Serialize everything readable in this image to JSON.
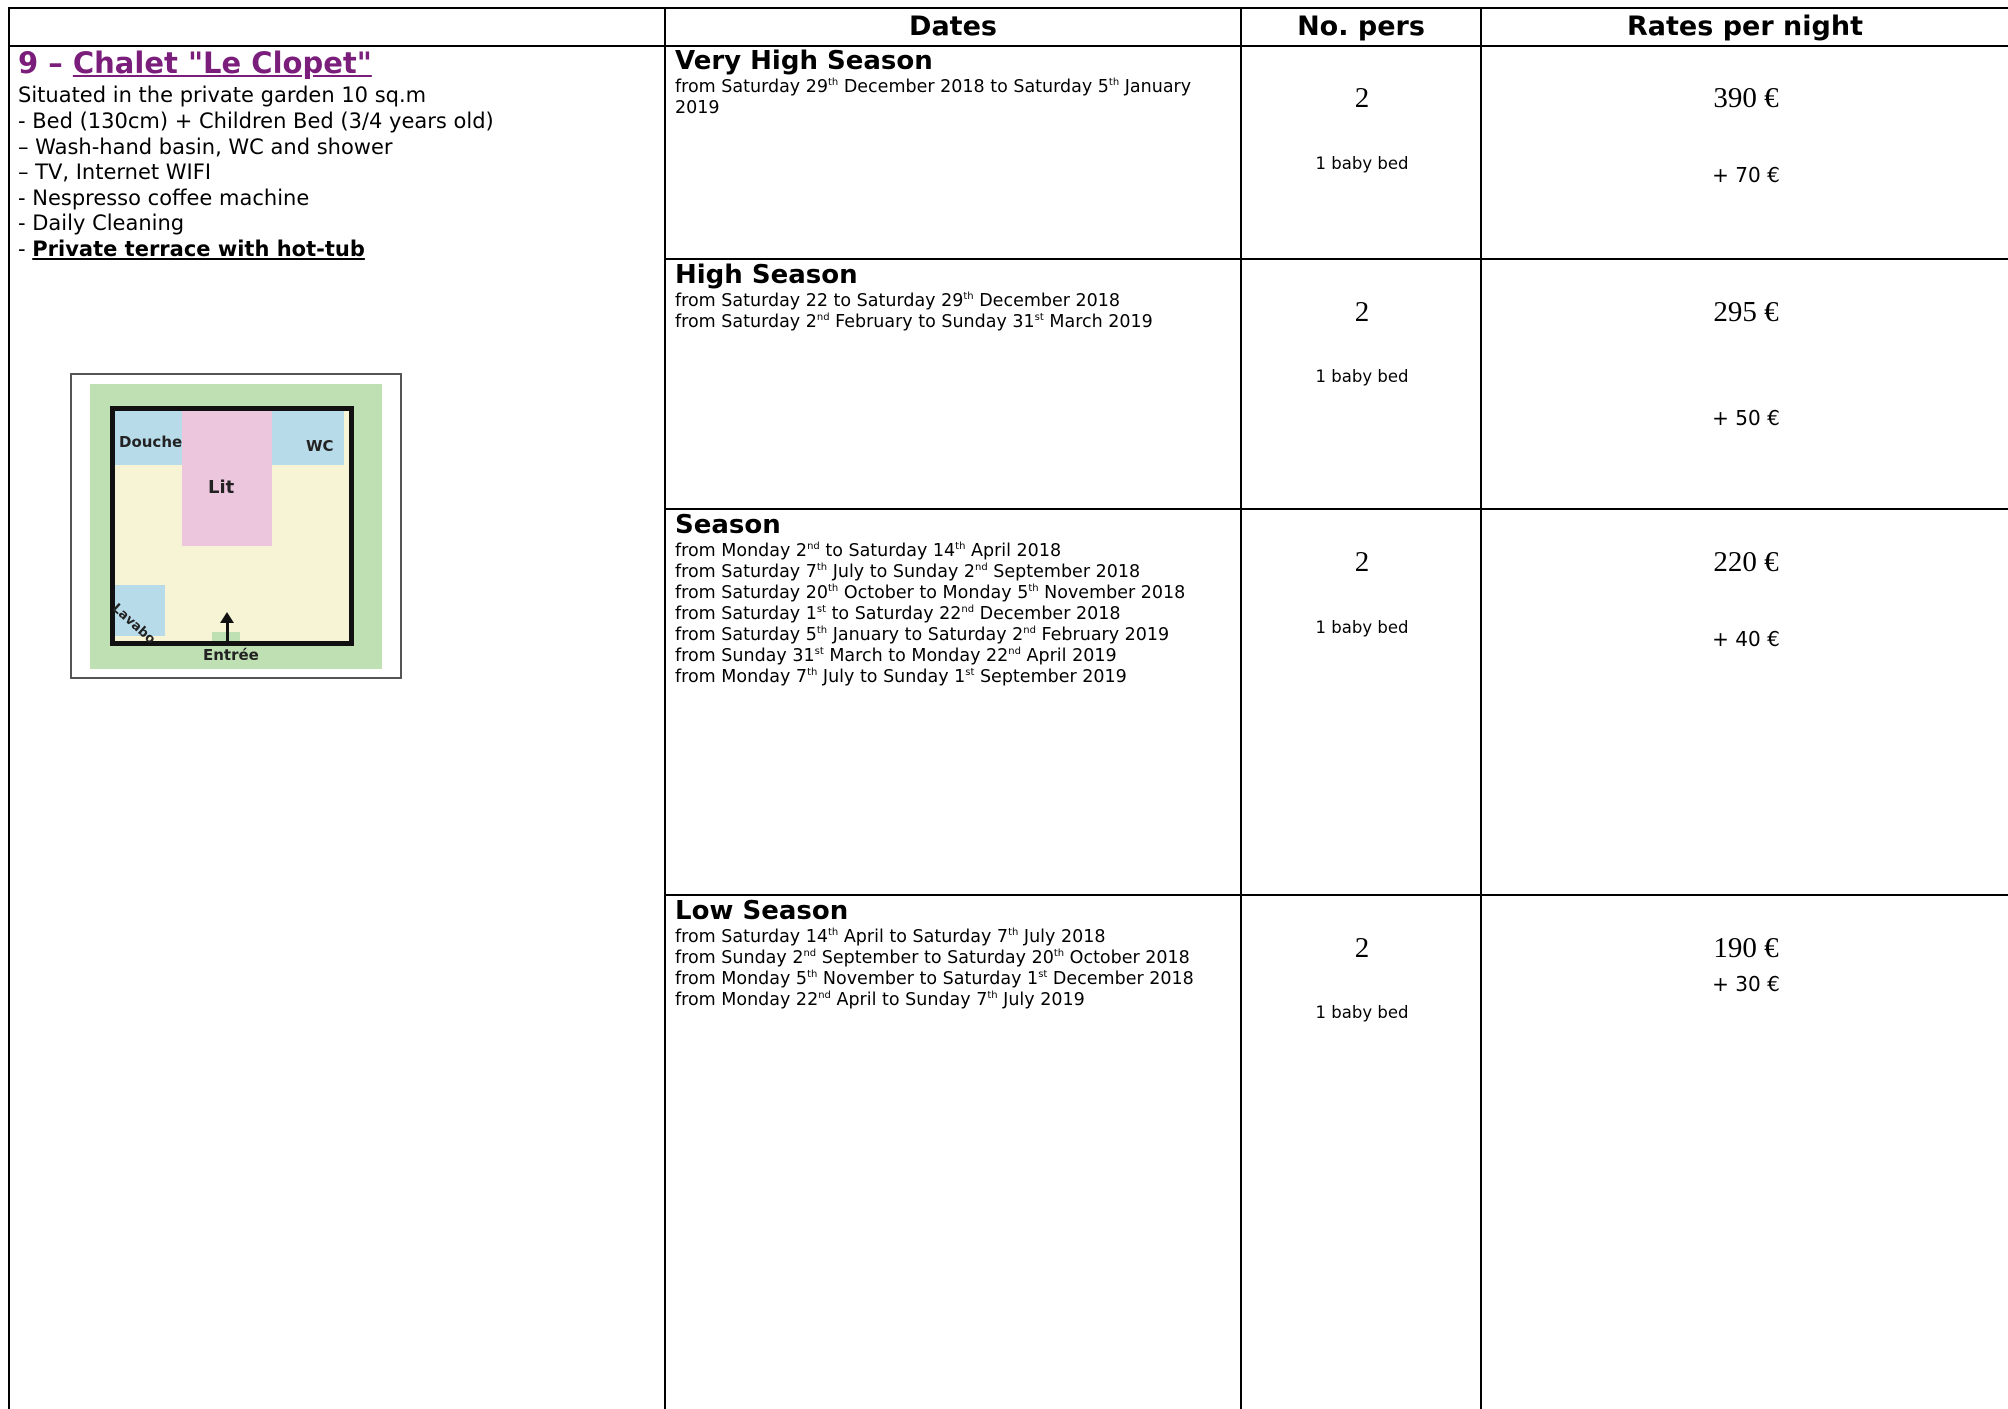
{
  "header": {
    "col_dates": "Dates",
    "col_pers": "No. pers",
    "col_rates": "Rates per night"
  },
  "room": {
    "title_number": "9 – ",
    "title_name": "Chalet \"Le Clopet\"",
    "title_color": "#7b1e7b",
    "description": [
      "Situated in the private garden 10 sq.m",
      "- Bed (130cm) + Children Bed (3/4 years old)",
      "– Wash-hand basin, WC and shower",
      "– TV, Internet WIFI",
      "- Nespresso coffee machine",
      "- Daily Cleaning"
    ],
    "highlight_prefix": "- ",
    "highlight": "Private terrace with hot-tub",
    "plan": {
      "douche": "Douche",
      "wc": "WC",
      "lit": "Lit",
      "lavabo": "Lavabo",
      "entree": "Entrée"
    }
  },
  "seasons": [
    {
      "name": "Very High Season",
      "lines": [
        "from Saturday 29^th December 2018 to Saturday 5^th January",
        "2019"
      ],
      "persons": "2",
      "extra_label": "1 baby bed",
      "price": "390 €",
      "extra_price": "+ 70 €"
    },
    {
      "name": "High Season",
      "lines": [
        "from Saturday 22 to Saturday 29^th December 2018",
        "from Saturday 2^nd February to Sunday 31^st March 2019"
      ],
      "persons": "2",
      "extra_label": "1 baby bed",
      "price": "295 €",
      "extra_price": "+ 50 €"
    },
    {
      "name": "Season",
      "lines": [
        "from Monday 2^nd  to Saturday 14^th April 2018",
        "from Saturday 7^th July to Sunday 2^nd September 2018",
        "from Saturday 20^th October to Monday 5^th November 2018",
        "from Saturday 1^st to Saturday 22^nd December 2018",
        "from Saturday 5^th January to Saturday 2^nd February 2019",
        "from Sunday 31^st March to Monday 22^nd April 2019",
        "from Monday 7^th July to Sunday 1^st September 2019"
      ],
      "persons": "2",
      "extra_label": "1 baby bed",
      "price": "220 €",
      "extra_price": "+ 40 €"
    },
    {
      "name": "Low Season",
      "lines": [
        "from Saturday 14^th April to Saturday 7^th July 2018",
        "from Sunday 2^nd September to Saturday 20^th October 2018",
        "from Monday 5^th November to Saturday 1^st December 2018",
        "from Monday 22^nd April to Sunday 7^th July 2019"
      ],
      "persons": "2",
      "extra_label": "1 baby bed",
      "price": "190 €",
      "extra_price": "+ 30 €"
    }
  ]
}
